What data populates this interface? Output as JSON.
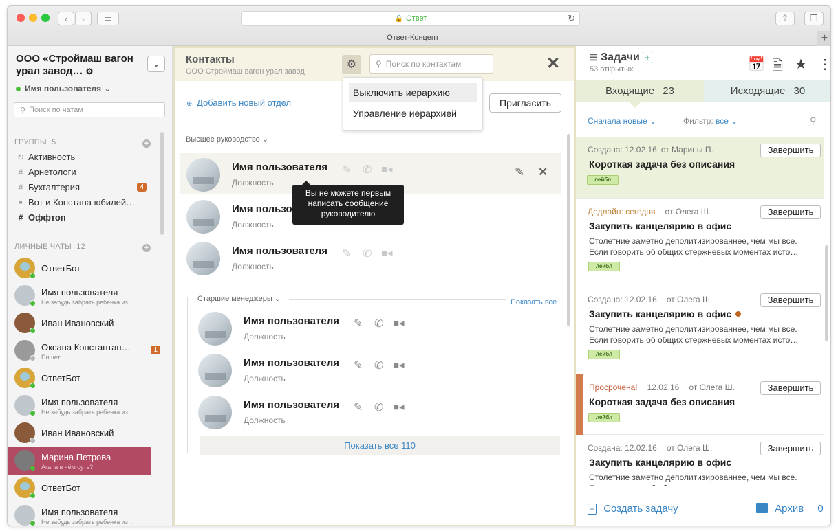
{
  "browser": {
    "url": "Ответ",
    "tab_title": "Ответ-Концепт"
  },
  "sidebar": {
    "company": "ООО «Строймаш вагон урал завод…",
    "user": "Имя пользователя",
    "search_placeholder": "Поиск по чатам",
    "groups_label": "ГРУППЫ",
    "groups_count": "5",
    "groups": [
      {
        "icon": "history-icon",
        "glyph": "↻",
        "label": "Активность",
        "badge": ""
      },
      {
        "icon": "hash-icon",
        "glyph": "#",
        "label": "Арнетологи",
        "badge": ""
      },
      {
        "icon": "hash-icon",
        "glyph": "#",
        "label": "Бухгалтерия",
        "badge": "4"
      },
      {
        "icon": "lock-icon",
        "glyph": "🔒",
        "label": "Вот и Констана юбилей…",
        "badge": ""
      },
      {
        "icon": "hash-icon",
        "glyph": "#",
        "label": "Оффтоп",
        "badge": ""
      }
    ],
    "personal_label": "ЛИЧНЫЕ ЧАТЫ",
    "personal_count": "12",
    "chats": [
      {
        "name": "ОтветБот",
        "preview": "",
        "badge": "",
        "presence": "#4cbb3a",
        "avatar": "#d8a638"
      },
      {
        "name": "Имя пользователя",
        "preview": "Не забудь забрать ребенка из…",
        "badge": "",
        "presence": "#4cbb3a",
        "avatar": "#c0c7cc"
      },
      {
        "name": "Иван Ивановский",
        "preview": "",
        "badge": "",
        "presence": "#4cbb3a",
        "avatar": "#8a5a3a"
      },
      {
        "name": "Оксана Константан…",
        "preview": "Пишет…",
        "badge": "1",
        "presence": "#b7b7b7",
        "avatar": "#9a9a9a"
      },
      {
        "name": "ОтветБот",
        "preview": "",
        "badge": "",
        "presence": "#4cbb3a",
        "avatar": "#d8a638"
      },
      {
        "name": "Имя пользователя",
        "preview": "Не забудь забрать ребенка из…",
        "badge": "",
        "presence": "#4cbb3a",
        "avatar": "#c0c7cc"
      },
      {
        "name": "Иван Ивановский",
        "preview": "",
        "badge": "",
        "presence": "#b7b7b7",
        "avatar": "#8a5a3a"
      },
      {
        "name": "Марина Петрова",
        "preview": "Ага, а в чём суть?",
        "badge": "",
        "presence": "#4cbb3a",
        "avatar": "#7a7a7a"
      },
      {
        "name": "ОтветБот",
        "preview": "",
        "badge": "",
        "presence": "#4cbb3a",
        "avatar": "#d8a638"
      },
      {
        "name": "Имя пользователя",
        "preview": "Не забудь забрать ребенка из…",
        "badge": "",
        "presence": "#4cbb3a",
        "avatar": "#c0c7cc"
      }
    ]
  },
  "contacts": {
    "title": "Контакты",
    "subtitle": "ООО Строймаш вагон урал завод",
    "search_placeholder": "Поиск по контактам",
    "add_department": "Добавить новый отдел",
    "invite": "Пригласить",
    "menu": [
      "Выключить иерархию",
      "Управление иерархией"
    ],
    "dept_top": "Высшее руководство",
    "dept_senior": "Старшие менеджеры",
    "show_all_link": "Показать все",
    "show_all_button": "Показать все 110",
    "tooltip": "Вы не можете первым написать сообщение руководителю",
    "top_contacts": [
      {
        "name": "Имя пользователя",
        "position": "Должность"
      },
      {
        "name": "Имя пользова",
        "position": "Должность"
      },
      {
        "name": "Имя пользователя",
        "position": "Должность"
      }
    ],
    "senior_contacts": [
      {
        "name": "Имя пользователя",
        "position": "Должность"
      },
      {
        "name": "Имя пользователя",
        "position": "Должность"
      },
      {
        "name": "Имя пользователя",
        "position": "Должность"
      }
    ]
  },
  "tasks": {
    "title": "Задачи",
    "open_count": "53 открытых",
    "incoming_label": "Входящие",
    "incoming_count": "23",
    "outgoing_label": "Исходящие",
    "outgoing_count": "30",
    "sort_label": "Сначала новые",
    "filter_label": "Фильтр:",
    "filter_value": "все",
    "complete_label": "Завершить",
    "tag_label": "ЛЕЙБЛ",
    "cards": [
      {
        "status": "Создана: 12.02.16",
        "status_color": "#777777",
        "date": "",
        "from": "от Марины П.",
        "title": "Короткая задача без описания",
        "desc": ""
      },
      {
        "status": "Дедлайн: сегодня",
        "status_color": "#c0853a",
        "date": "",
        "from": "от Олега Ш.",
        "title": "Закупить канцелярию в офис",
        "desc": "Столетние заметно деполитизированнее, чем мы все. Если говорить об общих стержневых моментах исто…"
      },
      {
        "status": "Создана: 12.02.16",
        "status_color": "#777777",
        "date": "",
        "from": "от Олега Ш.",
        "title": "Закупить канцелярию в офис",
        "desc": "Столетние заметно деполитизированнее, чем мы все. Если говорить об общих стержневых моментах исто…"
      },
      {
        "status": "Просрочена!",
        "status_color": "#c25a36",
        "date": "12.02.16",
        "from": "от Олега Ш.",
        "title": "Короткая задача без описания",
        "desc": ""
      },
      {
        "status": "Создана: 12.02.16",
        "status_color": "#777777",
        "date": "",
        "from": "от Олега Ш.",
        "title": "Закупить канцелярию в офис",
        "desc": "Столетние заметно деполитизированнее, чем мы все. Если говорить об общих стержневых моментах исто…"
      }
    ],
    "create_label": "Создать задачу",
    "archive_label": "Архив",
    "archive_count": "0"
  },
  "colors": {
    "active_chat": "#b14a62",
    "accent_link": "#3a86c4",
    "incoming_tab": "#e8efd9",
    "outgoing_tab": "#e3efec",
    "overdue": "#d17b4f"
  }
}
